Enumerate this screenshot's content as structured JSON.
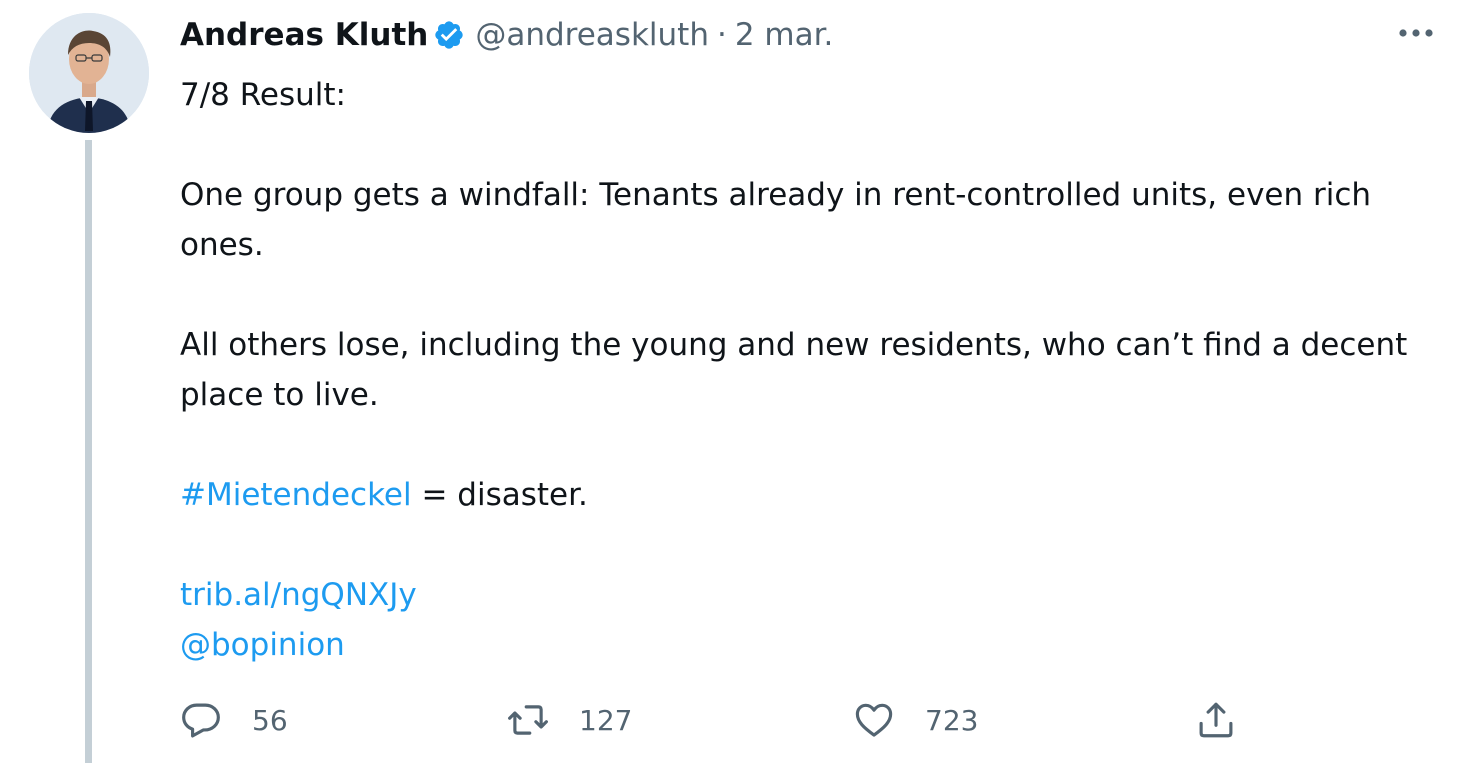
{
  "author": {
    "name": "Andreas Kluth",
    "handle": "@andreaskluth",
    "separator": "·",
    "date": "2 mar.",
    "verified": true
  },
  "tweet": {
    "lines": {
      "intro": "7/8 Result:",
      "para1": "One group gets a windfall: Tenants already in rent-controlled units, even rich ones.",
      "para2": "All others lose, including the young and new residents, who can’t find a decent place to live.",
      "hashtag": "#Mietendeckel",
      "hashtag_rest": " = disaster.",
      "url": "trib.al/ngQNXJy",
      "mention": "@bopinion"
    }
  },
  "actions": {
    "replies": "56",
    "retweets": "127",
    "likes": "723"
  },
  "icons": {
    "reply": "speech-bubble-icon",
    "retweet": "retweet-arrows-icon",
    "like": "heart-icon",
    "share": "share-upload-icon",
    "more": "more-dots-icon",
    "verified": "verified-badge-icon"
  },
  "colors": {
    "link": "#1d9bf0",
    "text": "#0f1419",
    "secondary": "#536471",
    "thread_line": "#c4cfd6",
    "verified": "#1d9bf0"
  }
}
